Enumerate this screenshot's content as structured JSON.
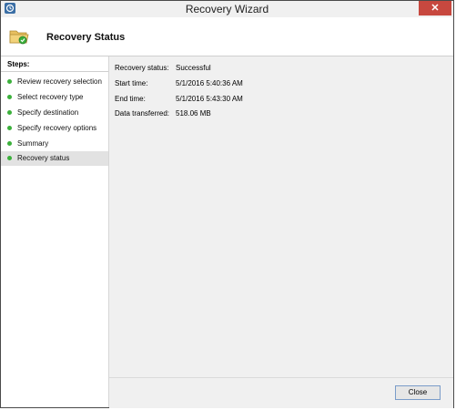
{
  "window": {
    "title": "Recovery Wizard",
    "close_glyph": "✕"
  },
  "header": {
    "title": "Recovery Status",
    "icon": "folder-restore-icon"
  },
  "sidebar": {
    "heading": "Steps:",
    "items": [
      {
        "label": "Review recovery selection",
        "status": "complete"
      },
      {
        "label": "Select recovery type",
        "status": "complete"
      },
      {
        "label": "Specify destination",
        "status": "complete"
      },
      {
        "label": "Specify recovery options",
        "status": "complete"
      },
      {
        "label": "Summary",
        "status": "complete"
      },
      {
        "label": "Recovery status",
        "status": "complete",
        "active": true
      }
    ]
  },
  "status": {
    "rows": [
      {
        "key": "Recovery status:",
        "value": "Successful"
      },
      {
        "key": "Start time:",
        "value": "5/1/2016 5:40:36 AM"
      },
      {
        "key": "End time:",
        "value": "5/1/2016 5:43:30 AM"
      },
      {
        "key": "Data transferred:",
        "value": "518.06 MB"
      }
    ]
  },
  "footer": {
    "close_label": "Close"
  },
  "colors": {
    "step_complete": "#3bb03b",
    "button_border": "#7a9cc9",
    "titlebar_close": "#c7483f"
  }
}
